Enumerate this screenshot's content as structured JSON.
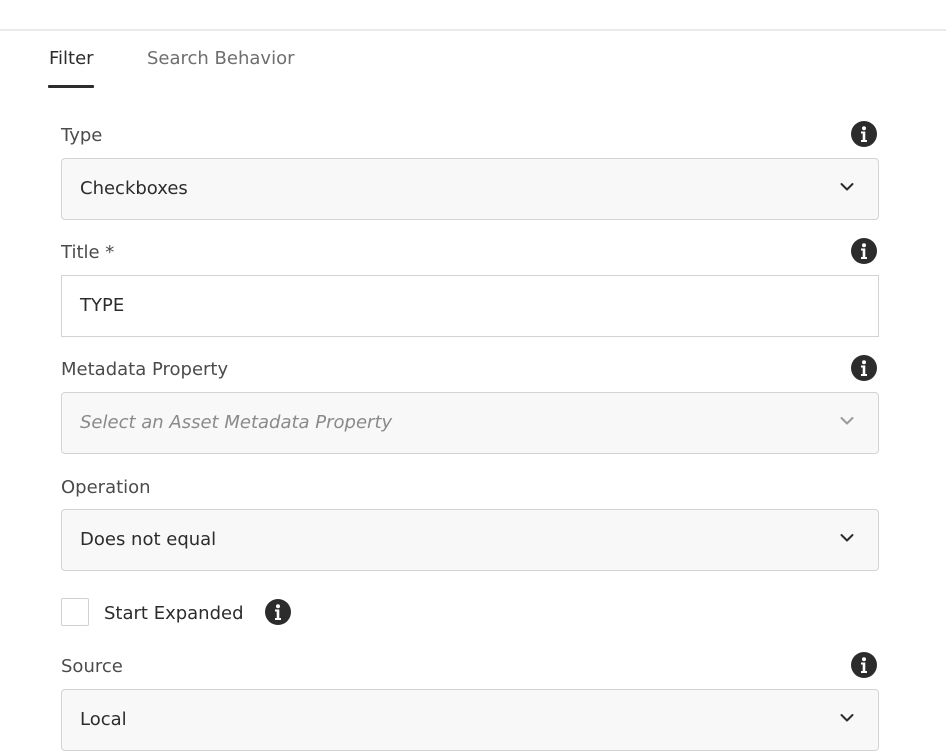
{
  "tabs": [
    {
      "label": "Filter",
      "selected": true
    },
    {
      "label": "Search Behavior",
      "selected": false
    }
  ],
  "type": {
    "label": "Type",
    "value": "Checkboxes",
    "info_icon": "info-icon"
  },
  "title": {
    "label": "Title *",
    "value": "TYPE",
    "info_icon": "info-icon"
  },
  "metadata": {
    "label": "Metadata Property",
    "placeholder": "Select an Asset Metadata Property",
    "info_icon": "info-icon"
  },
  "operation": {
    "label": "Operation",
    "value": "Does not equal"
  },
  "start_expanded": {
    "label": "Start Expanded",
    "checked": false,
    "info_icon": "info-icon"
  },
  "source": {
    "label": "Source",
    "value": "Local",
    "info_icon": "info-icon"
  },
  "colors": {
    "text": "#2c2c2c",
    "muted": "#6e6e6e",
    "border": "#d3d3d3",
    "field_bg": "#f8f8f8"
  }
}
